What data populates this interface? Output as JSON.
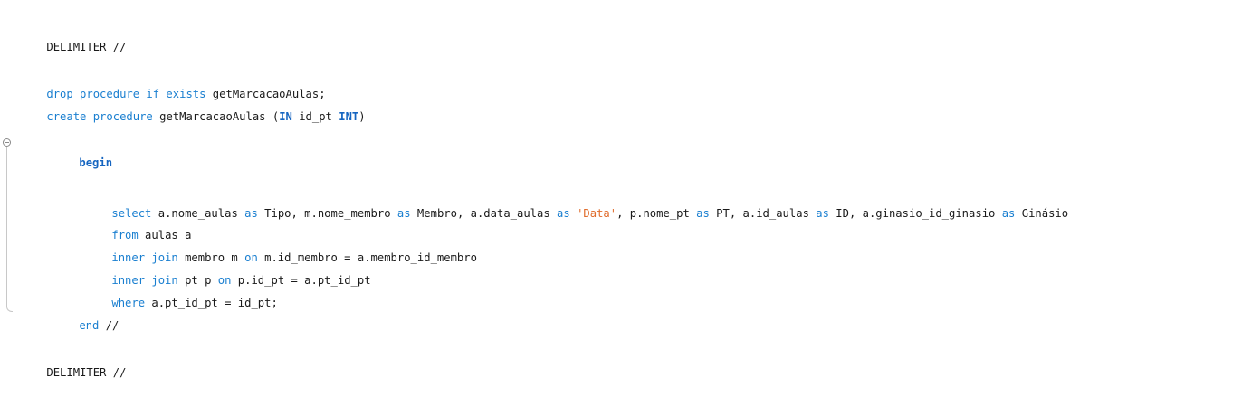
{
  "code": {
    "delimiter_top": "DELIMITER //",
    "drop_kw": "drop procedure if exists",
    "drop_name": " getMarcacaoAulas;",
    "create_kw": "create procedure",
    "create_name": " getMarcacaoAulas (",
    "in_kw": "IN",
    "param_name": " id_pt ",
    "int_kw": "INT",
    "create_close": ")",
    "begin_kw": "begin",
    "select_kw": "select",
    "select_p1": " a.nome_aulas ",
    "as1": "as",
    "select_p2": " Tipo, m.nome_membro ",
    "as2": "as",
    "select_p3": " Membro, a.data_aulas ",
    "as3": "as",
    "select_str": "'Data'",
    "select_p4": ", p.nome_pt ",
    "as4": "as",
    "select_p5": " PT, a.id_aulas ",
    "as5": "as",
    "select_p6": " ID, a.ginasio_id_ginasio ",
    "as6": "as",
    "select_p7": " Ginásio",
    "from_kw": "from",
    "from_rest": " aulas a",
    "ij1_kw": "inner join",
    "ij1_a": " membro m ",
    "on1_kw": "on",
    "ij1_b": " m.id_membro = a.membro_id_membro",
    "ij2_kw": "inner join",
    "ij2_a": " pt p ",
    "on2_kw": "on",
    "ij2_b": " p.id_pt = a.pt_id_pt",
    "where_kw": "where",
    "where_rest": " a.pt_id_pt = id_pt;",
    "end_kw": "end",
    "end_rest": " //",
    "delimiter_bottom": "DELIMITER //"
  },
  "colors": {
    "keyword": "#1a7fd0",
    "string": "#e06c2c",
    "text": "#1a1a1a"
  },
  "icons": {
    "fold": "collapse-circle-icon"
  }
}
